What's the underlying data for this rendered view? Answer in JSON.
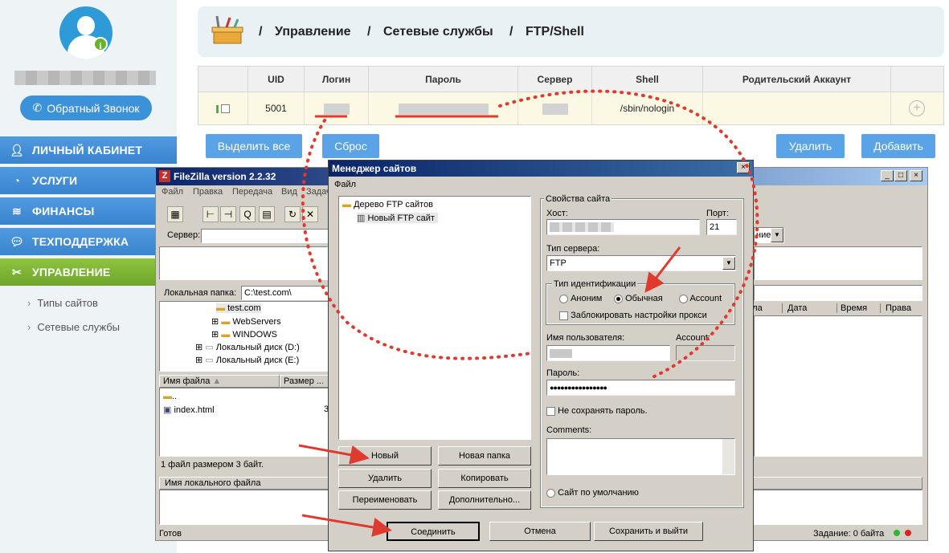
{
  "sidebar": {
    "callback_label": "Обратный Звонок",
    "nav": [
      {
        "label": "ЛИЧНЫЙ КАБИНЕТ",
        "icon": "user-icon"
      },
      {
        "label": "УСЛУГИ",
        "icon": "speedometer-icon"
      },
      {
        "label": "ФИНАНСЫ",
        "icon": "coins-icon"
      },
      {
        "label": "ТЕХПОДДЕРЖКА",
        "icon": "chat-icon"
      },
      {
        "label": "УПРАВЛЕНИЕ",
        "icon": "tools-icon"
      }
    ],
    "subitems": [
      "Типы сайтов",
      "Сетевые службы"
    ]
  },
  "breadcrumb": {
    "sep": "/",
    "items": [
      "Управление",
      "Сетевые службы",
      "FTP/Shell"
    ]
  },
  "table": {
    "columns": [
      "UID",
      "Логин",
      "Пароль",
      "Сервер",
      "Shell",
      "Родительский Аккаунт"
    ],
    "row": {
      "uid": "5001",
      "shell": "/sbin/nologin"
    }
  },
  "actions": {
    "select_all": "Выделить все",
    "reset": "Сброс",
    "delete": "Удалить",
    "add": "Добавить"
  },
  "filezilla": {
    "title": "FileZilla version 2.2.32",
    "menu": [
      "Файл",
      "Правка",
      "Передача",
      "Вид",
      "Задач"
    ],
    "server_label": "Сервер:",
    "local_folder_label": "Локальная папка:",
    "local_folder_value": "C:\\test.com\\",
    "tree": [
      "test.com",
      "WebServers",
      "WINDOWS",
      "Локальный диск (D:)",
      "Локальный диск (E:)"
    ],
    "file_columns": [
      "Имя файла",
      "Размер ..."
    ],
    "files": [
      "..",
      "index.html"
    ],
    "file_size": "3",
    "status_files": "1 файл размером 3 байт.",
    "queue_column": "Имя локального файла",
    "status_ready": "Готов",
    "status_task": "Задание: 0 байта",
    "remote_columns": [
      "йла",
      "Дата",
      "Время",
      "Права"
    ],
    "remote_dropdown": "ние"
  },
  "site_manager": {
    "title": "Менеджер сайтов",
    "menu_file": "Файл",
    "tree_root": "Дерево FTP сайтов",
    "tree_child": "Новый FTP сайт",
    "props_title": "Свойства сайта",
    "host_label": "Хост:",
    "port_label": "Порт:",
    "port_value": "21",
    "server_type_label": "Тип сервера:",
    "server_type_value": "FTP",
    "auth_group": "Тип идентификации",
    "auth_anon": "Аноним",
    "auth_normal": "Обычная",
    "auth_account": "Account",
    "block_proxy": "Заблокировать настройки прокси",
    "username_label": "Имя пользователя:",
    "account_label": "Account:",
    "password_label": "Пароль:",
    "password_value": "●●●●●●●●●●●●●●●●",
    "no_save_password": "Не сохранять пароль.",
    "comments_label": "Comments:",
    "default_site": "Сайт по умолчанию",
    "btn_new": "Новый",
    "btn_new_folder": "Новая папка",
    "btn_delete": "Удалить",
    "btn_copy": "Копировать",
    "btn_rename": "Переименовать",
    "btn_more": "Дополнительно...",
    "btn_connect": "Соединить",
    "btn_cancel": "Отмена",
    "btn_save_exit": "Сохранить и выйти"
  },
  "colors": {
    "nav_blue": "#3a84cf",
    "nav_active": "#6ea52b",
    "header_bg": "#e9f1f5",
    "row_bg": "#fbf9e4",
    "button_blue": "#5aa3e6",
    "annotation_red": "#e03a2f"
  }
}
